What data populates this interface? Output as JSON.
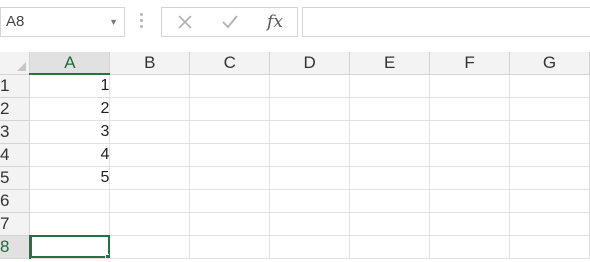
{
  "formula_bar": {
    "name_box_value": "A8",
    "cancel_icon": "close-icon",
    "enter_icon": "check-icon",
    "function_label": "fx",
    "formula_value": ""
  },
  "grid": {
    "columns": [
      "A",
      "B",
      "C",
      "D",
      "E",
      "F",
      "G"
    ],
    "active_column": "A",
    "rows": [
      {
        "label": "1",
        "cells": [
          "1",
          "",
          "",
          "",
          "",
          "",
          ""
        ]
      },
      {
        "label": "2",
        "cells": [
          "2",
          "",
          "",
          "",
          "",
          "",
          ""
        ]
      },
      {
        "label": "3",
        "cells": [
          "3",
          "",
          "",
          "",
          "",
          "",
          ""
        ]
      },
      {
        "label": "4",
        "cells": [
          "4",
          "",
          "",
          "",
          "",
          "",
          ""
        ]
      },
      {
        "label": "5",
        "cells": [
          "5",
          "",
          "",
          "",
          "",
          "",
          ""
        ]
      },
      {
        "label": "6",
        "cells": [
          "",
          "",
          "",
          "",
          "",
          "",
          ""
        ]
      },
      {
        "label": "7",
        "cells": [
          "",
          "",
          "",
          "",
          "",
          "",
          ""
        ]
      },
      {
        "label": "8",
        "cells": [
          "",
          "",
          "",
          "",
          "",
          "",
          ""
        ]
      }
    ],
    "active_row": "8",
    "selected_cell": "A8"
  },
  "colors": {
    "accent": "#217346",
    "header_bg": "#f3f3f3",
    "active_header_bg": "#e1e1e1",
    "gridline": "#e1e1e1"
  }
}
